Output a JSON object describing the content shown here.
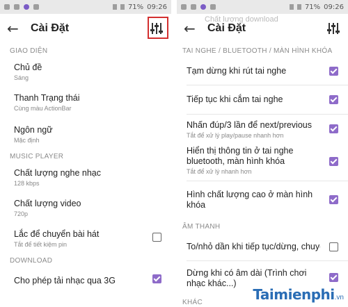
{
  "left": {
    "status": {
      "time": "09:26",
      "battery": "71%"
    },
    "toolbar": {
      "back": "←",
      "title": "Cài Đặt"
    },
    "sections": {
      "interface": "GIAO DIỆN",
      "music_player": "MUSIC PLAYER",
      "download": "DOWNLOAD"
    },
    "items": {
      "theme": {
        "title": "Chủ đề",
        "sub": "Sáng"
      },
      "statusbar": {
        "title": "Thanh Trạng thái",
        "sub": "Cùng màu ActionBar"
      },
      "language": {
        "title": "Ngôn ngữ",
        "sub": "Mặc định"
      },
      "music_quality": {
        "title": "Chất lượng nghe nhạc",
        "sub": "128 kbps"
      },
      "video_quality": {
        "title": "Chất lượng video",
        "sub": "720p"
      },
      "shake": {
        "title": "Lắc để chuyển bài hát",
        "sub": "Tắt để tiết kiệm pin",
        "checked": false
      },
      "download_3g": {
        "title": "Cho phép tải nhạc qua 3G",
        "checked": true
      }
    }
  },
  "right": {
    "status": {
      "time": "09:26",
      "battery": "71%"
    },
    "toolbar": {
      "back": "←",
      "title": "Cài Đặt",
      "ghost": "Chất lượng download"
    },
    "sections": {
      "headset": "TAI NGHE / BLUETOOTH / MÀN HÌNH KHÓA",
      "sound": "ÂM THANH",
      "other": "KHÁC"
    },
    "items": {
      "pause_unplug": {
        "title": "Tạm dừng khi rút tai nghe",
        "checked": true
      },
      "resume_plug": {
        "title": "Tiếp tục khi cắm tai nghe",
        "checked": true
      },
      "double_press": {
        "title": "Nhấn đúp/3 lần để next/previous",
        "sub": "Tắt để xử lý play/pause nhanh hơn",
        "checked": true
      },
      "bt_info": {
        "title": "Hiển thị thông tin ở tai nghe bluetooth, màn hình khóa",
        "sub": "Tắt để xử lý nhanh hơn",
        "checked": true
      },
      "lock_hq": {
        "title": "Hình chất lượng cao ở màn hình khóa",
        "checked": true
      },
      "fade": {
        "title": "To/nhỏ dần khi tiếp tục/dừng, chuyển b...",
        "checked": false
      },
      "silence": {
        "title": "Dừng khi có âm dài (Trình chơi nhạc khác...)",
        "checked": true
      }
    }
  },
  "watermark": {
    "brand": "Taimienphi",
    "tld": ".vn"
  },
  "colors": {
    "accent": "#8e6bc9",
    "highlight": "#d32f2f"
  }
}
